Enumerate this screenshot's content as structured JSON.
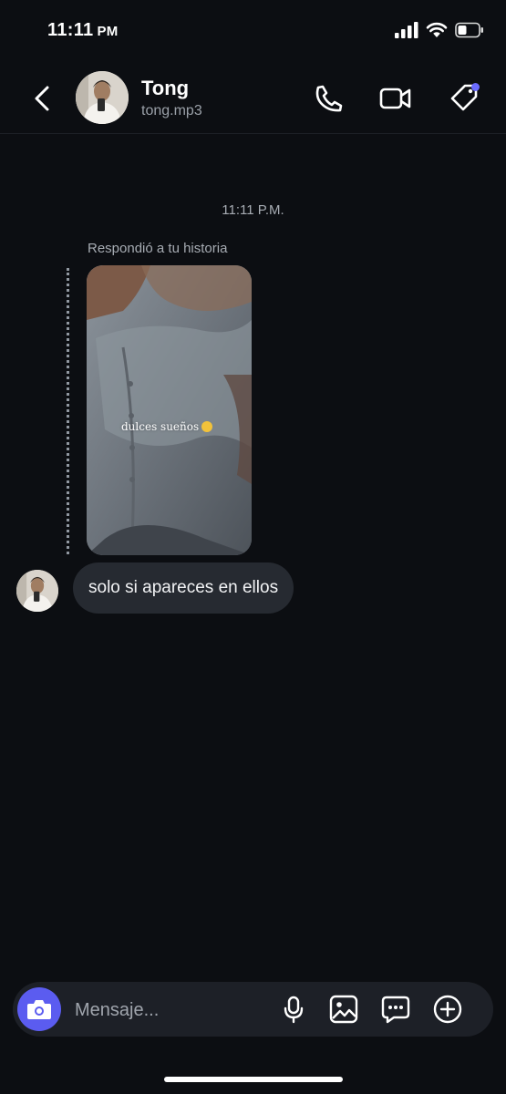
{
  "status_bar": {
    "time": "11:11",
    "ampm": "PM"
  },
  "header": {
    "contact_name": "Tong",
    "contact_handle": "tong.mp3",
    "back_icon": "chevron-left-icon",
    "call_icon": "phone-icon",
    "video_icon": "video-camera-icon",
    "tag_icon": "tag-icon",
    "notification_dot_color": "#6b6bff"
  },
  "conversation": {
    "timestamp": "11:11 P.M.",
    "reply_label": "Respondió a tu historia",
    "story": {
      "caption": "dulces sueños"
    },
    "messages": [
      {
        "sender": "Tong",
        "text": "solo si apareces en ellos"
      }
    ]
  },
  "composer": {
    "placeholder": "Mensaje...",
    "camera_button_color": "#5b5cf0",
    "icons": [
      "camera-icon",
      "microphone-icon",
      "image-icon",
      "chat-bubble-icon",
      "plus-circle-icon"
    ]
  },
  "colors": {
    "background": "#0c0e12",
    "bubble": "#262a31",
    "composer": "#1d2027"
  }
}
